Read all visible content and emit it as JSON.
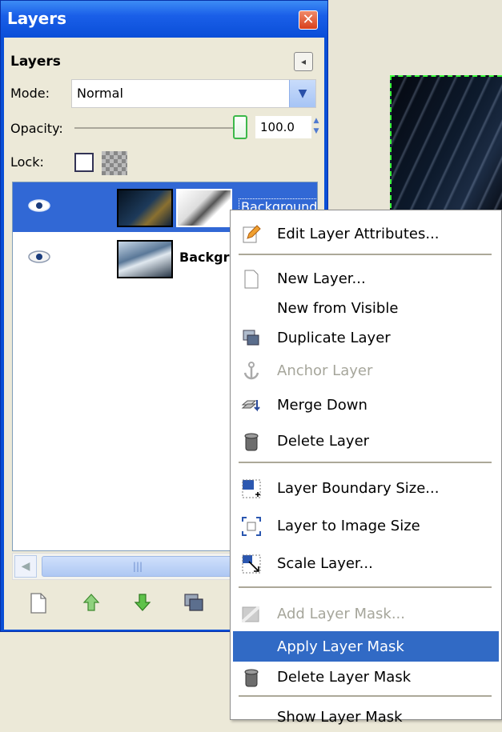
{
  "window": {
    "title": "Layers",
    "close_glyph": "✕"
  },
  "panel": {
    "title": "Layers",
    "menu_glyph": "◂"
  },
  "mode": {
    "label": "Mode:",
    "value": "Normal"
  },
  "opacity": {
    "label": "Opacity:",
    "value": "100.0",
    "slider_fraction": 1.0
  },
  "lock": {
    "label": "Lock:"
  },
  "layers": [
    {
      "name": "Background",
      "selected": true,
      "visible": true,
      "has_mask": true
    },
    {
      "name": "Backgr",
      "selected": false,
      "visible": true,
      "has_mask": false
    }
  ],
  "scrollbar": {
    "thumb_glyph": "|||"
  },
  "toolbar": [
    "new-layer-icon",
    "raise-layer-icon",
    "lower-layer-icon",
    "duplicate-layer-icon"
  ],
  "context_menu": {
    "items": [
      {
        "label": "Edit Layer Attributes...",
        "icon": "edit-icon",
        "enabled": true
      },
      {
        "label": "New Layer...",
        "icon": "new-layer-icon",
        "enabled": true
      },
      {
        "label": "New from Visible",
        "icon": "",
        "enabled": true
      },
      {
        "label": "Duplicate Layer",
        "icon": "duplicate-icon",
        "enabled": true
      },
      {
        "label": "Anchor Layer",
        "icon": "anchor-icon",
        "enabled": false
      },
      {
        "label": "Merge Down",
        "icon": "merge-down-icon",
        "enabled": true
      },
      {
        "label": "Delete Layer",
        "icon": "delete-icon",
        "enabled": true
      },
      {
        "label": "Layer Boundary Size...",
        "icon": "boundary-size-icon",
        "enabled": true
      },
      {
        "label": "Layer to Image Size",
        "icon": "to-image-size-icon",
        "enabled": true
      },
      {
        "label": "Scale Layer...",
        "icon": "scale-icon",
        "enabled": true
      },
      {
        "label": "Add Layer Mask...",
        "icon": "add-mask-icon",
        "enabled": false
      },
      {
        "label": "Apply Layer Mask",
        "icon": "",
        "enabled": true,
        "highlighted": true
      },
      {
        "label": "Delete Layer Mask",
        "icon": "delete-mask-icon",
        "enabled": true
      },
      {
        "label": "Show Layer Mask",
        "icon": "",
        "enabled": true
      }
    ]
  },
  "colors": {
    "selection": "#316ac5",
    "title_bar": "#0a4ed8",
    "disabled_text": "#a6a69b"
  }
}
